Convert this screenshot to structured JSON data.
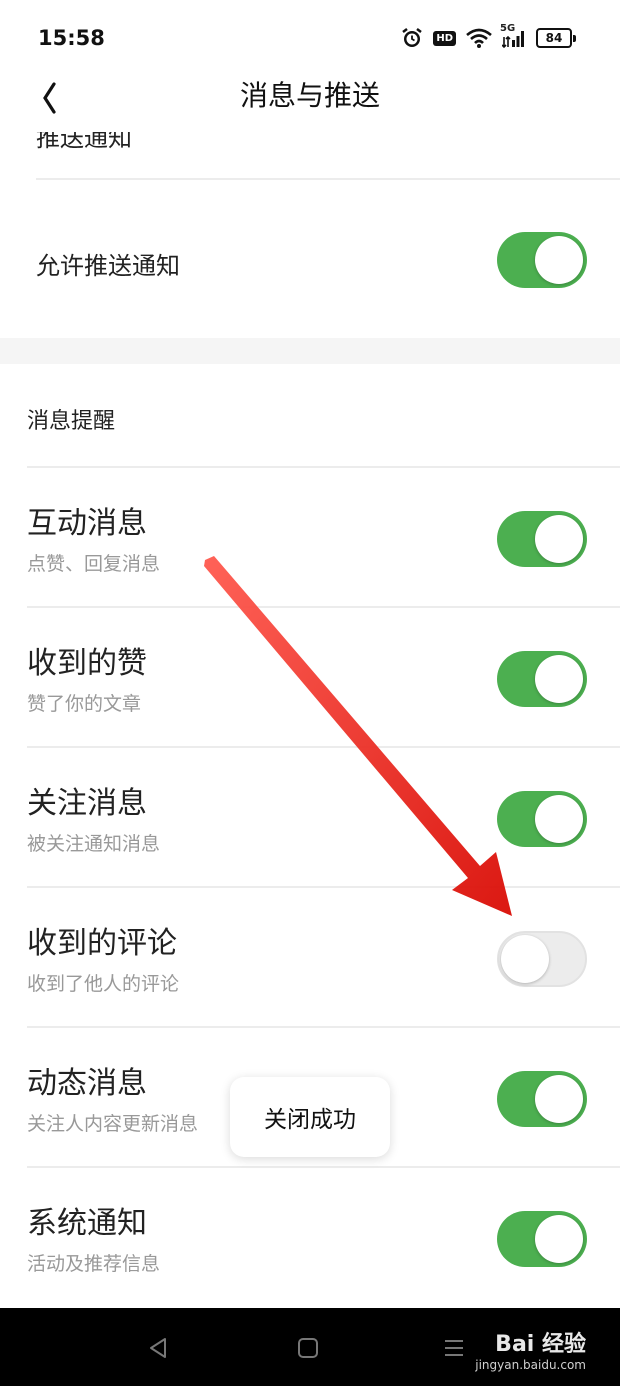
{
  "status": {
    "time": "15:58",
    "hd": "HD",
    "network": "5G",
    "battery": "84"
  },
  "header": {
    "title": "消息与推送"
  },
  "push_section": {
    "cut_label": "推送通知",
    "allow_label": "允许推送通知",
    "allow_on": true
  },
  "section": {
    "label": "消息提醒"
  },
  "items": [
    {
      "title": "互动消息",
      "subtitle": "点赞、回复消息",
      "on": true
    },
    {
      "title": "收到的赞",
      "subtitle": "赞了你的文章",
      "on": true
    },
    {
      "title": "关注消息",
      "subtitle": "被关注通知消息",
      "on": true
    },
    {
      "title": "收到的评论",
      "subtitle": "收到了他人的评论",
      "on": false
    },
    {
      "title": "动态消息",
      "subtitle": "关注人内容更新消息",
      "on": true
    },
    {
      "title": "系统通知",
      "subtitle": "活动及推荐信息",
      "on": true
    }
  ],
  "toast": {
    "text": "关闭成功"
  },
  "watermark": {
    "brand": "Bai 经验",
    "url": "jingyan.baidu.com"
  },
  "colors": {
    "toggle_on": "#4caf50",
    "toggle_off": "#ececec",
    "arrow": "#e8140f"
  }
}
